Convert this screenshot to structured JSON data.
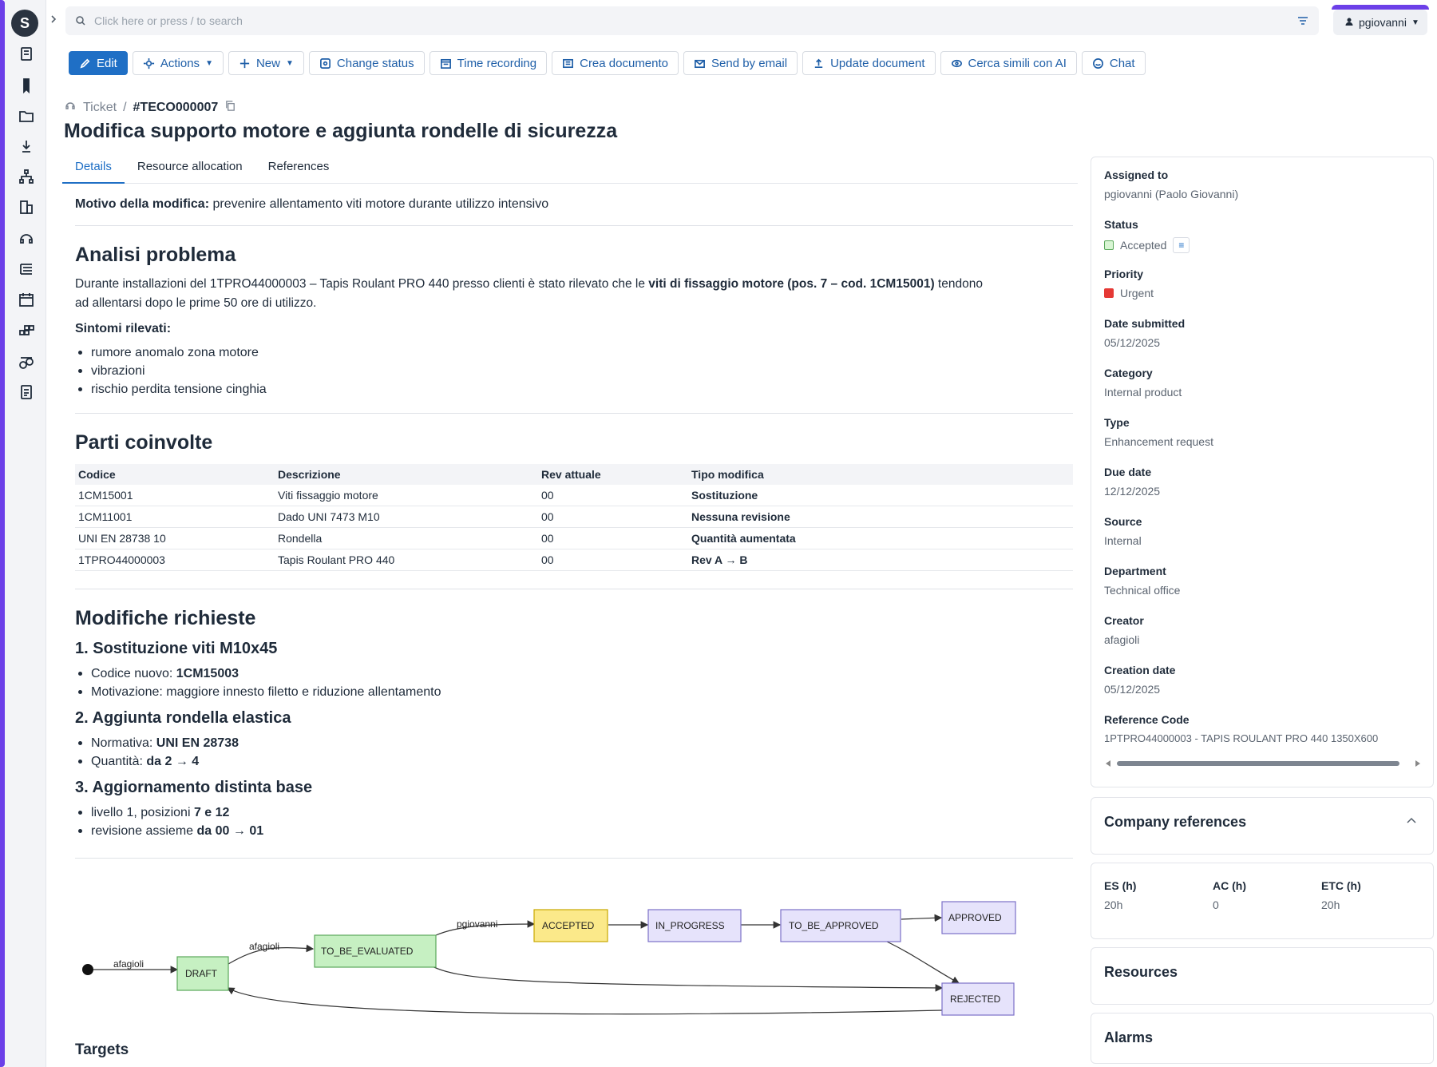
{
  "search": {
    "placeholder": "Click here or press / to search"
  },
  "user": {
    "name": "pgiovanni"
  },
  "toolbar": {
    "edit": "Edit",
    "actions": "Actions",
    "new": "New",
    "change_status": "Change status",
    "time_recording": "Time recording",
    "crea_documento": "Crea documento",
    "send_by_email": "Send by email",
    "update_document": "Update document",
    "cerca_simili": "Cerca simili con AI",
    "chat": "Chat"
  },
  "breadcrumb": {
    "parent": "Ticket",
    "separator": "/",
    "code": "#TECO000007"
  },
  "page_title": "Modifica supporto motore e aggiunta rondelle di sicurezza",
  "tabs": [
    "Details",
    "Resource allocation",
    "References"
  ],
  "body": {
    "motivo_label": "Motivo della modifica:",
    "motivo_text": " prevenire allentamento viti motore durante utilizzo intensivo",
    "analisi_title": "Analisi problema",
    "analisi_p1": "Durante installazioni del 1TPRO44000003 – Tapis Roulant PRO 440 presso clienti è stato rilevato che le ",
    "analisi_bold": "viti di fissaggio motore (pos. 7 – cod. 1CM15001)",
    "analisi_p2": " tendono",
    "analisi_p3": "ad allentarsi dopo le prime 50 ore di utilizzo.",
    "sintomi_label": "Sintomi rilevati:",
    "sintomi": [
      "rumore anomalo zona motore",
      "vibrazioni",
      "rischio perdita tensione cinghia"
    ],
    "parti_title": "Parti coinvolte",
    "parti_headers": [
      "Codice",
      "Descrizione",
      "Rev attuale",
      "Tipo modifica"
    ],
    "parti_rows": [
      [
        "1CM15001",
        "Viti fissaggio motore",
        "00",
        "Sostituzione"
      ],
      [
        "1CM11001",
        "Dado UNI 7473 M10",
        "00",
        "Nessuna revisione"
      ],
      [
        "UNI EN 28738 10",
        "Rondella",
        "00",
        "Quantità aumentata"
      ],
      [
        "1TPRO44000003",
        "Tapis Roulant PRO 440",
        "00",
        "Rev A → B"
      ]
    ],
    "modifiche_title": "Modifiche richieste",
    "m1_title": "1. Sostituzione viti M10x45",
    "m1_a_pre": "Codice nuovo: ",
    "m1_a_bold": "1CM15003",
    "m1_b": "Motivazione: maggiore innesto filetto e riduzione allentamento",
    "m2_title": "2. Aggiunta rondella elastica",
    "m2_a_pre": "Normativa: ",
    "m2_a_bold": "UNI EN 28738",
    "m2_b_pre": "Quantità: ",
    "m2_b_bold1": "da 2",
    "m2_b_arrow": " → ",
    "m2_b_bold2": "4",
    "m3_title": "3. Aggiornamento distinta base",
    "m3_a_pre": "livello 1, posizioni ",
    "m3_a_bold": "7 e 12",
    "m3_b_pre": "revisione assieme ",
    "m3_b_bold1": "da 00",
    "m3_b_arrow": " → ",
    "m3_b_bold2": "01",
    "targets": "Targets"
  },
  "workflow": {
    "states": [
      "DRAFT",
      "TO_BE_EVALUATED",
      "ACCEPTED",
      "IN_PROGRESS",
      "TO_BE_APPROVED",
      "APPROVED",
      "REJECTED"
    ],
    "edge_labels": [
      "afagioli",
      "afagioli",
      "pgiovanni"
    ],
    "current": "ACCEPTED"
  },
  "panel": {
    "assigned_label": "Assigned to",
    "assigned": "pgiovanni (Paolo Giovanni)",
    "status_label": "Status",
    "status": "Accepted",
    "priority_label": "Priority",
    "priority": "Urgent",
    "date_submitted_label": "Date submitted",
    "date_submitted": "05/12/2025",
    "category_label": "Category",
    "category": "Internal product",
    "type_label": "Type",
    "type": "Enhancement request",
    "due_label": "Due date",
    "due": "12/12/2025",
    "source_label": "Source",
    "source": "Internal",
    "department_label": "Department",
    "department": "Technical office",
    "creator_label": "Creator",
    "creator": "afagioli",
    "creation_label": "Creation date",
    "creation": "05/12/2025",
    "refcode_label": "Reference Code",
    "refcode": "1PTPRO44000003 - TAPIS ROULANT PRO 440 1350X600"
  },
  "company_references": "Company references",
  "hours": {
    "es_label": "ES (h)",
    "es": "20h",
    "ac_label": "AC (h)",
    "ac": "0",
    "etc_label": "ETC (h)",
    "etc": "20h"
  },
  "resources": "Resources",
  "alarms": "Alarms",
  "colors": {
    "accent": "#6c3fe8",
    "primary": "#1f6fc5",
    "accepted": "#fbe98a",
    "green": "#c6f0c2",
    "violet": "#e6e3fb",
    "urgent": "#e53935"
  }
}
